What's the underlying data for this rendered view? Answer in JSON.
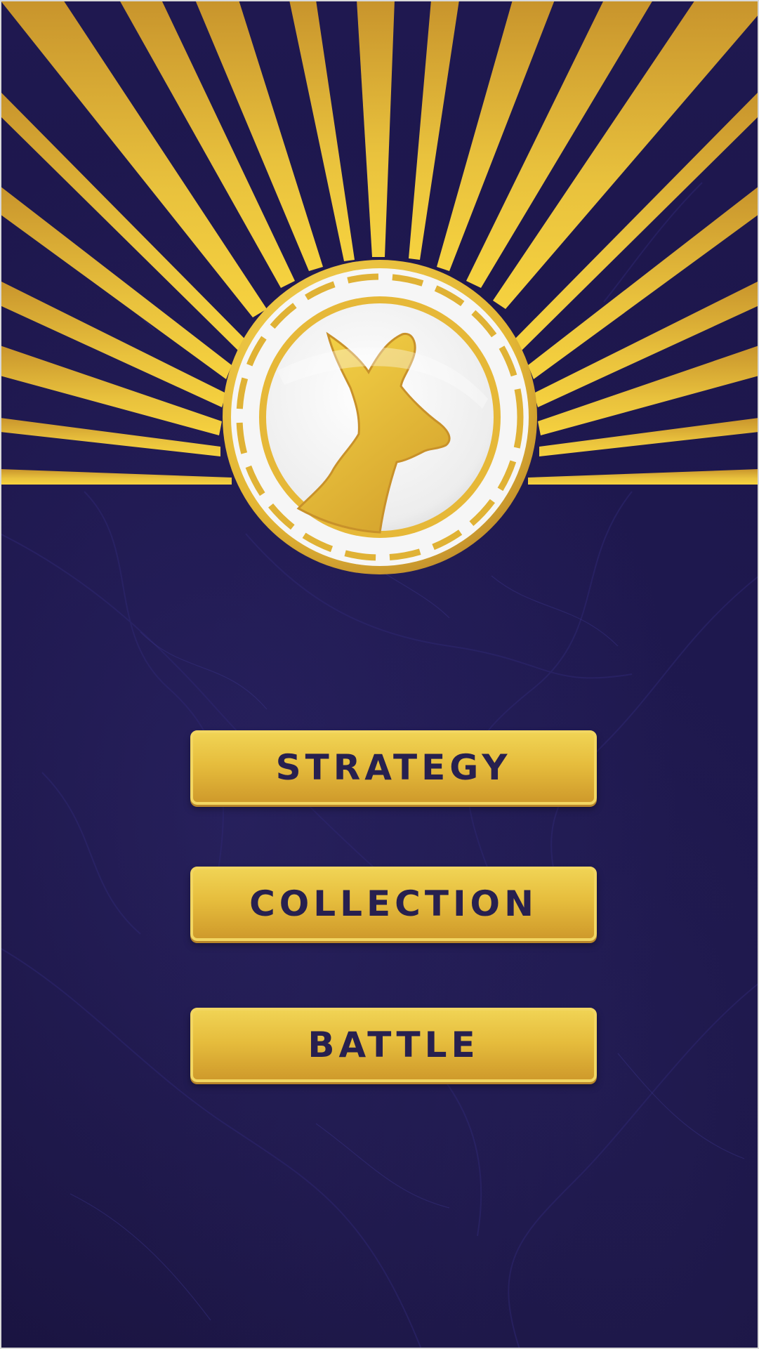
{
  "app": {
    "emblem": "kangaroo-head-icon"
  },
  "menu": {
    "strategy_label": "STRATEGY",
    "collection_label": "COLLECTION",
    "battle_label": "BATTLE"
  },
  "colors": {
    "background": "#1b1548",
    "gold": "#e8c13f",
    "gold_dark": "#c38f28",
    "button_text": "#27204f",
    "coin_face": "#f3f3f3"
  }
}
